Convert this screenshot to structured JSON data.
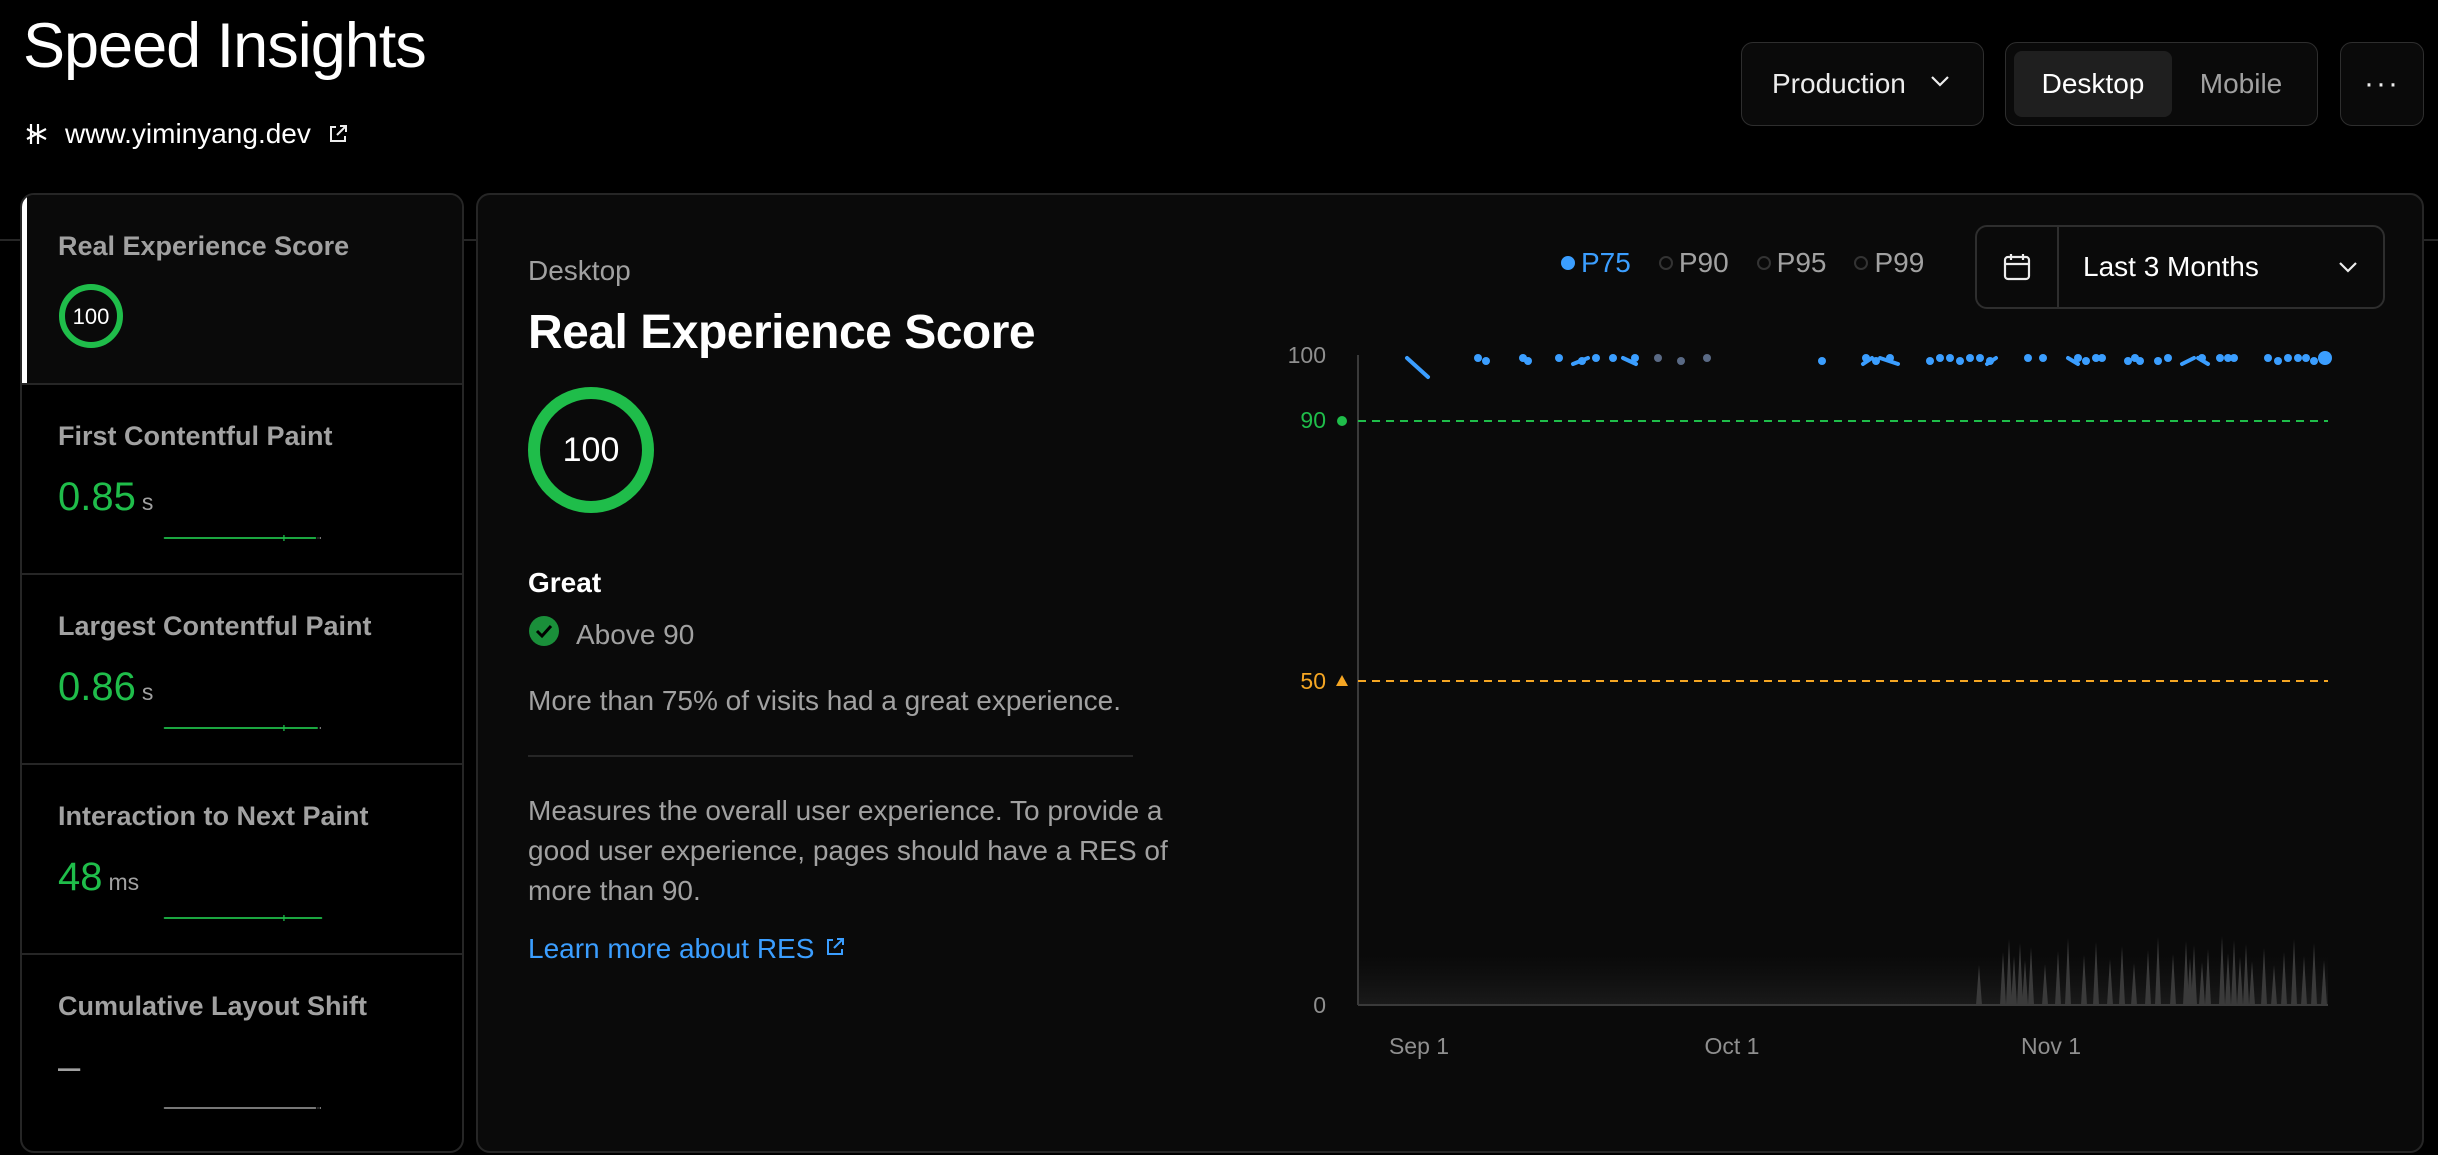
{
  "header": {
    "title": "Speed Insights",
    "site": "www.yiminyang.dev",
    "environment": "Production",
    "device_tabs": [
      "Desktop",
      "Mobile"
    ],
    "active_device": "Desktop",
    "more_label": "···"
  },
  "sidebar": {
    "metrics": [
      {
        "label": "Real Experience Score",
        "value": "100",
        "unit": "",
        "active": true
      },
      {
        "label": "First Contentful Paint",
        "value": "0.85",
        "unit": "s",
        "active": false
      },
      {
        "label": "Largest Contentful Paint",
        "value": "0.86",
        "unit": "s",
        "active": false
      },
      {
        "label": "Interaction to Next Paint",
        "value": "48",
        "unit": "ms",
        "active": false
      },
      {
        "label": "Cumulative Layout Shift",
        "value": "–",
        "unit": "",
        "active": false
      }
    ]
  },
  "panel": {
    "subtitle": "Desktop",
    "title": "Real Experience Score",
    "score": "100",
    "rating": "Great",
    "threshold": "Above 90",
    "summary": "More than 75% of visits had a great experience.",
    "description": "Measures the overall user experience. To provide a good user experience, pages should have a RES of more than 90.",
    "learn_more": "Learn more about RES"
  },
  "legend": {
    "items": [
      "P75",
      "P90",
      "P95",
      "P99"
    ],
    "active": "P75"
  },
  "date_range": "Last 3 Months",
  "colors": {
    "good": "#1fbd4a",
    "warn": "#f5a623",
    "accent": "#3b9eff",
    "border": "#262626"
  },
  "chart_data": {
    "type": "line",
    "series": [
      {
        "name": "P75"
      }
    ],
    "ylim": [
      0,
      100
    ],
    "yticks": [
      "100",
      "90",
      "50",
      "0"
    ],
    "xticks": [
      "Sep 1",
      "Oct 1",
      "Nov 1"
    ],
    "thresholds": [
      {
        "value": 90,
        "label": "90",
        "color": "#1fbd4a"
      },
      {
        "value": 50,
        "label": "50",
        "color": "#f5a623"
      }
    ]
  }
}
